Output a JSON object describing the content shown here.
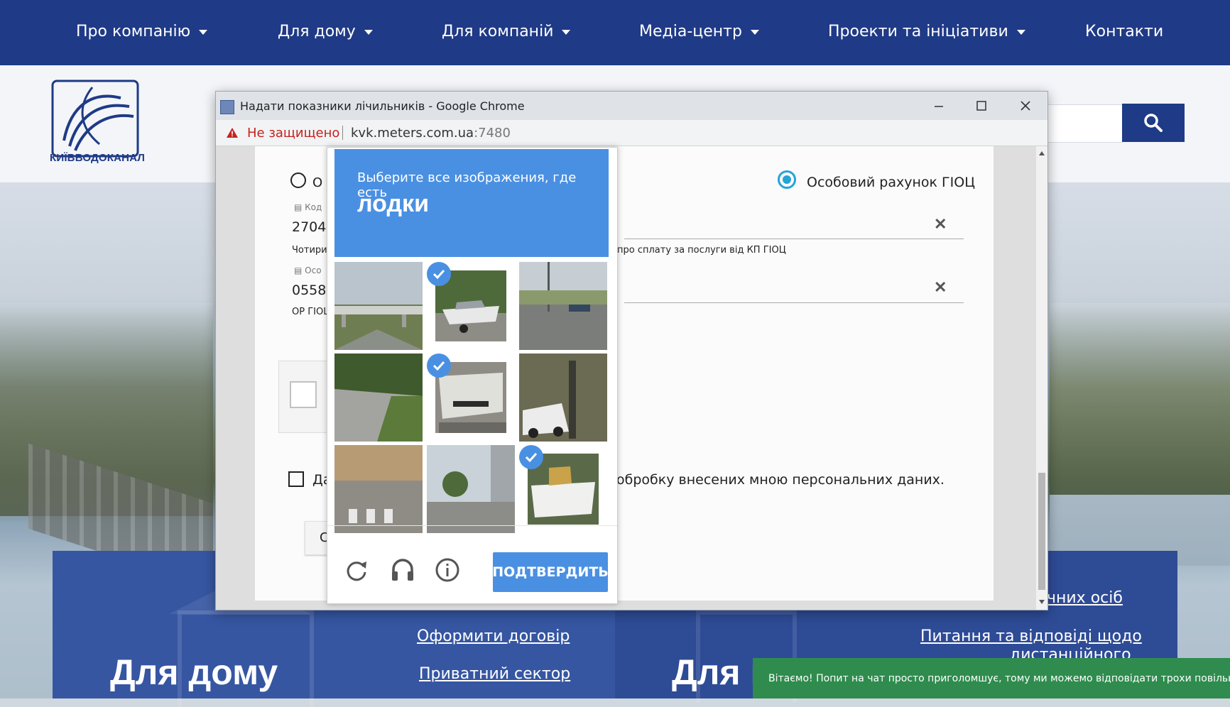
{
  "site_nav": {
    "items": [
      {
        "label": "Про компанію",
        "has_dropdown": true
      },
      {
        "label": "Для дому",
        "has_dropdown": true
      },
      {
        "label": "Для компаній",
        "has_dropdown": true
      },
      {
        "label": "Медіа-центр",
        "has_dropdown": true
      },
      {
        "label": "Проекти та ініціативи",
        "has_dropdown": true
      },
      {
        "label": "Контакти",
        "has_dropdown": false
      }
    ]
  },
  "site_header": {
    "logo_text": "КИЇВВОДОКАНАЛ",
    "search_icon": "search-icon"
  },
  "panels": {
    "left": {
      "title": "Для дому",
      "links": [
        "Оформити договір",
        "Приватний сектор"
      ]
    },
    "right": {
      "title": "Для к",
      "links": [
        "чних осіб",
        "Питання та відповіді щодо",
        "дистанційного"
      ]
    }
  },
  "chat_banner": "Вітаємо! Попит на чат просто приголомшує, тому ми можемо відповідати трохи повільніше, ні",
  "chrome": {
    "title": "Надати показники лічильників - Google Chrome",
    "security_label": "Не защищено",
    "url_host": "kvk.meters.com.ua",
    "url_port": ":7480"
  },
  "form": {
    "radio_left_label": "О",
    "radio_right_label": "Особовий рахунок ГІОЦ",
    "field1": {
      "label": "Код",
      "value": "2704",
      "hint": "Чотири",
      "hint_right": "про сплату за послуги від КП ГІОЦ"
    },
    "field2": {
      "label": "Осо",
      "value": "05582",
      "hint": "ОР ГІОЦ"
    },
    "consent_left": "Да",
    "consent_right": "обробку внесених мною персональних даних.",
    "button_stub": "С"
  },
  "captcha": {
    "instruction": "Выберите все изображения, где есть",
    "target": "лодки",
    "tiles": [
      {
        "name": "overpass",
        "selected": false
      },
      {
        "name": "boat-on-trailer",
        "selected": true
      },
      {
        "name": "street-truck",
        "selected": false
      },
      {
        "name": "road-curve",
        "selected": false
      },
      {
        "name": "boat-hull",
        "selected": true
      },
      {
        "name": "suv-car",
        "selected": false
      },
      {
        "name": "crosswalk",
        "selected": false
      },
      {
        "name": "intersection",
        "selected": false
      },
      {
        "name": "boat-white",
        "selected": true
      }
    ],
    "confirm_label": "ПОДТВЕРДИТЬ",
    "icons": [
      "reload-icon",
      "headphones-icon",
      "info-icon"
    ]
  }
}
